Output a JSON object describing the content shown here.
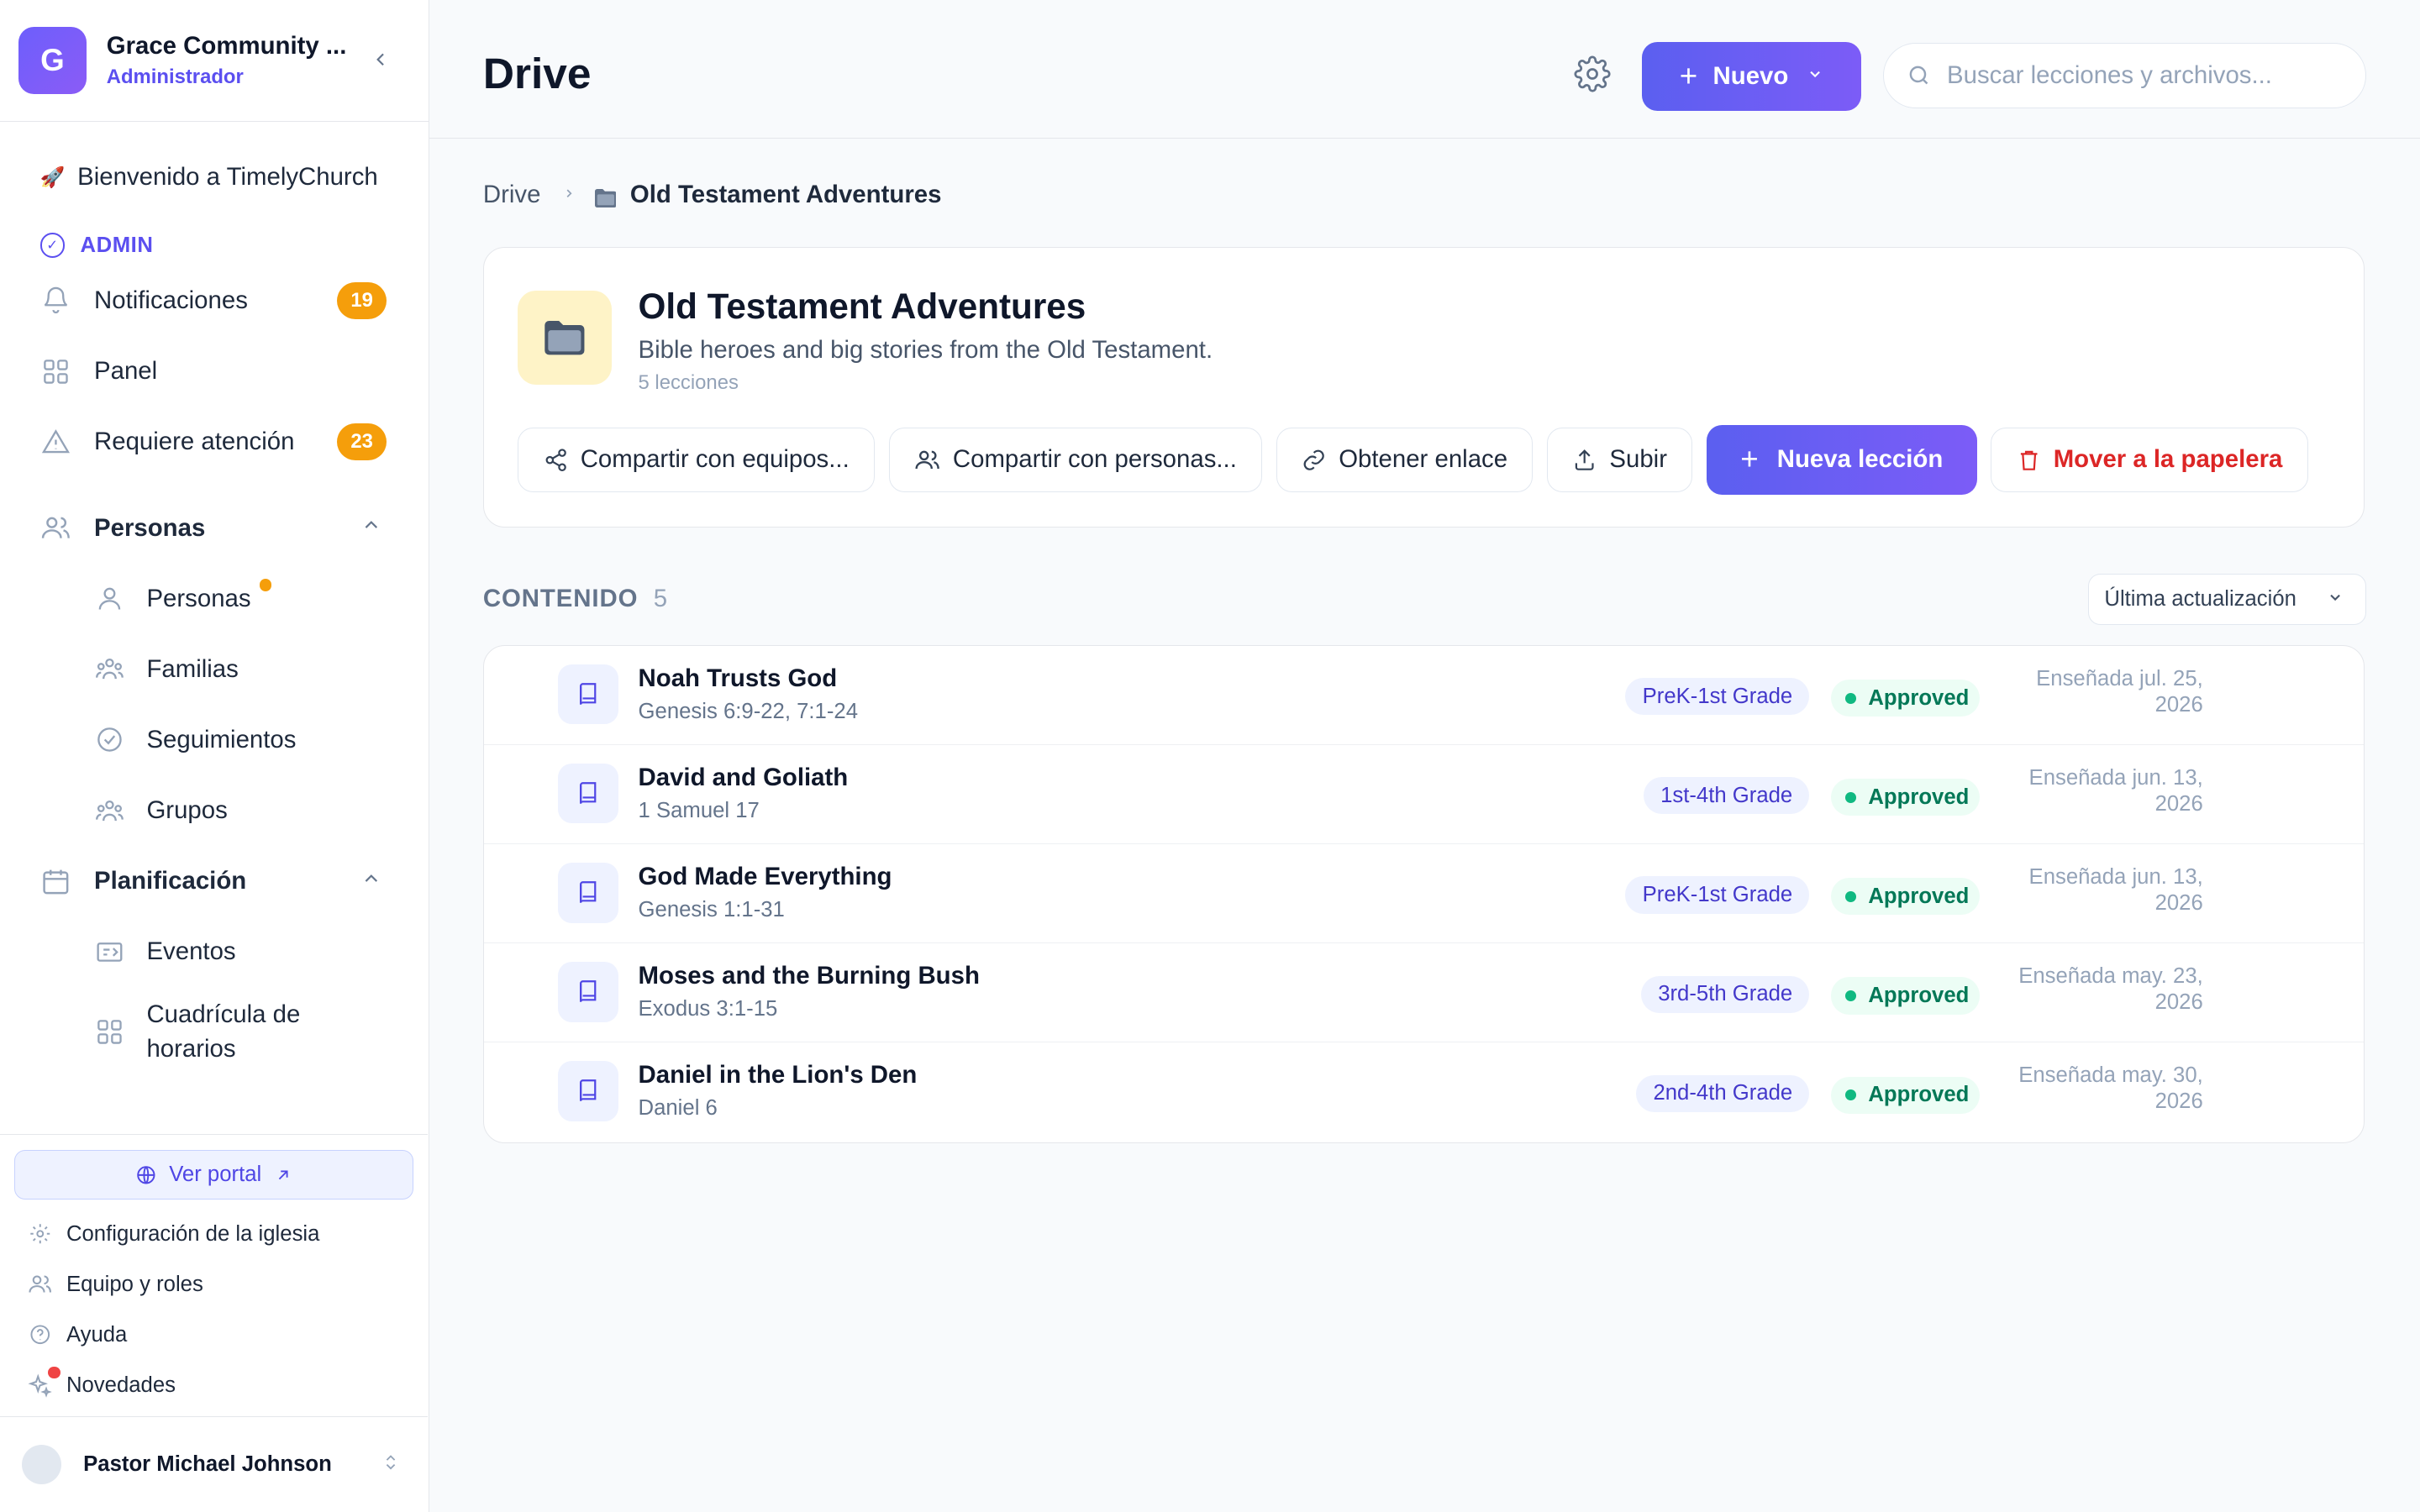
{
  "org": {
    "initial": "G",
    "name": "Grace Community ...",
    "role": "Administrador"
  },
  "nav": {
    "welcome": "Bienvenido a TimelyChurch",
    "admin_label": "ADMIN",
    "notifications": {
      "label": "Notificaciones",
      "badge": "19"
    },
    "panel": "Panel",
    "attention": {
      "label": "Requiere atención",
      "badge": "23"
    },
    "people_section": "Personas",
    "people_items": [
      "Personas",
      "Familias",
      "Seguimientos",
      "Grupos"
    ],
    "planning_section": "Planificación",
    "planning_items": [
      "Eventos",
      "Cuadrícula de horarios"
    ]
  },
  "bottom": {
    "portal": "Ver portal",
    "items": [
      "Configuración de la iglesia",
      "Equipo y roles",
      "Ayuda",
      "Novedades"
    ],
    "user": "Pastor Michael Johnson"
  },
  "header": {
    "title": "Drive",
    "new_label": "Nuevo",
    "search_placeholder": "Buscar lecciones y archivos..."
  },
  "breadcrumb": {
    "root": "Drive",
    "current": "Old Testament Adventures"
  },
  "folder": {
    "title": "Old Testament Adventures",
    "description": "Bible heroes and big stories from the Old Testament.",
    "count": "5 lecciones",
    "actions": {
      "share_teams": "Compartir con equipos...",
      "share_people": "Compartir con personas...",
      "get_link": "Obtener enlace",
      "upload": "Subir",
      "new_lesson": "Nueva lección",
      "trash": "Mover a la papelera"
    }
  },
  "content": {
    "label": "CONTENIDO",
    "count": "5",
    "sort": "Última actualización",
    "lessons": [
      {
        "title": "Noah Trusts God",
        "ref": "Genesis 6:9-22, 7:1-24",
        "grade": "PreK-1st Grade",
        "status": "Approved",
        "taught": "Enseñada jul. 25,",
        "year": "2026"
      },
      {
        "title": "David and Goliath",
        "ref": "1 Samuel 17",
        "grade": "1st-4th Grade",
        "status": "Approved",
        "taught": "Enseñada jun. 13,",
        "year": "2026"
      },
      {
        "title": "God Made Everything",
        "ref": "Genesis 1:1-31",
        "grade": "PreK-1st Grade",
        "status": "Approved",
        "taught": "Enseñada jun. 13,",
        "year": "2026"
      },
      {
        "title": "Moses and the Burning Bush",
        "ref": "Exodus 3:1-15",
        "grade": "3rd-5th Grade",
        "status": "Approved",
        "taught": "Enseñada may. 23,",
        "year": "2026"
      },
      {
        "title": "Daniel in the Lion's Den",
        "ref": "Daniel 6",
        "grade": "2nd-4th Grade",
        "status": "Approved",
        "taught": "Enseñada may. 30,",
        "year": "2026"
      }
    ]
  },
  "colors": {
    "accent": "#5b5ff0",
    "warning": "#f59e0b",
    "danger": "#dc2626",
    "success": "#10b981"
  }
}
